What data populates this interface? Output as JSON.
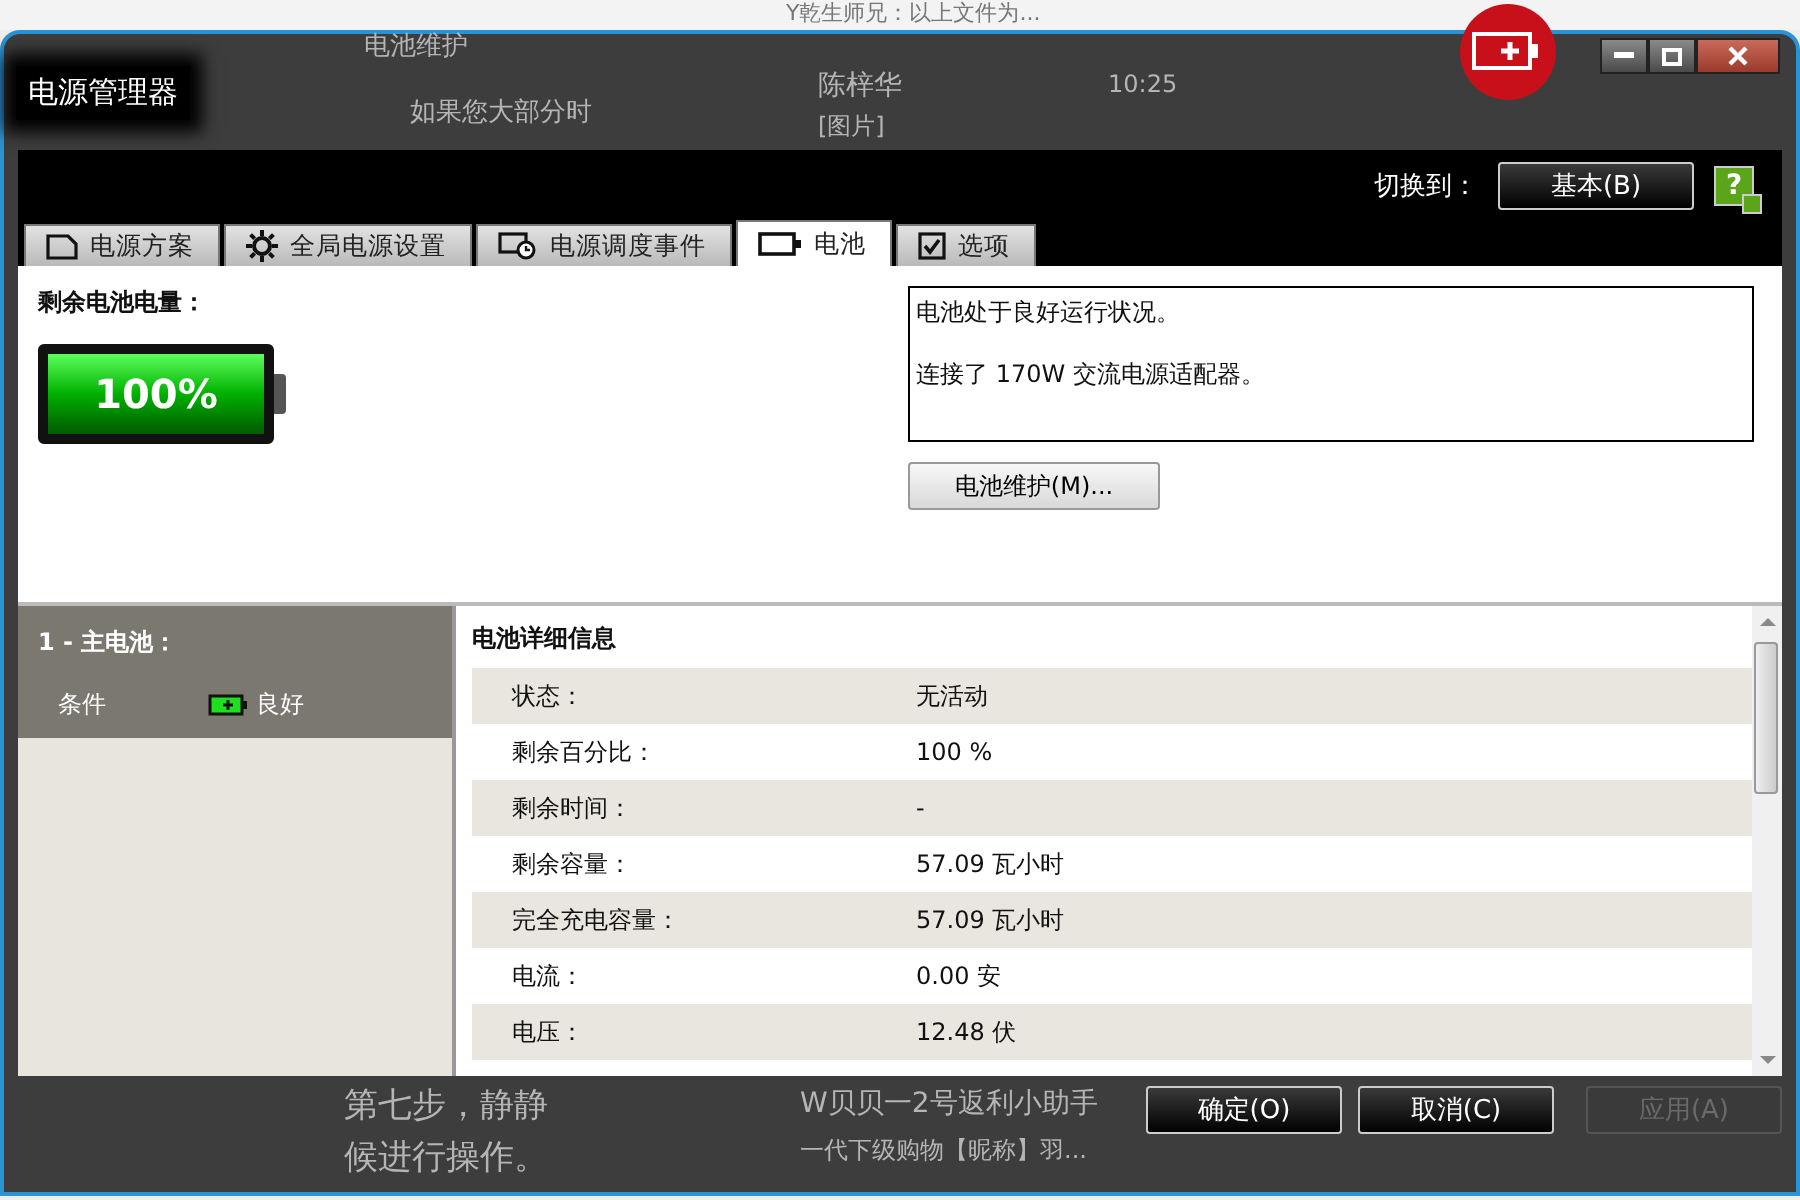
{
  "background": {
    "top_text": "Y乾生师兄：以上文件为...",
    "heading": "电池维护",
    "note": "如果您大部分时",
    "contact_name": "陈梓华",
    "contact_time": "10:25",
    "contact_message": "[图片]",
    "step_line_1": "第七步，静静",
    "step_line_2": "候进行操作。",
    "chat_name": "W贝贝一2号返利小助手",
    "chat_message": "一代下级购物【昵称】羽..."
  },
  "window": {
    "title": "电源管理器"
  },
  "switch": {
    "label": "切换到：",
    "button": "基本(B)",
    "help": "?"
  },
  "tabs": [
    {
      "label": "电源方案",
      "selected": false
    },
    {
      "label": "全局电源设置",
      "selected": false
    },
    {
      "label": "电源调度事件",
      "selected": false
    },
    {
      "label": "电池",
      "selected": true
    },
    {
      "label": "选项",
      "selected": false
    }
  ],
  "charge": {
    "label": "剩余电池电量：",
    "reading": "100%",
    "level": 1.0
  },
  "status_box": [
    "电池处于良好运行状况。",
    "连接了 170W 交流电源适配器。"
  ],
  "maintenance_button": "电池维护(M)...",
  "battery_list": {
    "title": "1 - 主电池：",
    "condition_label": "条件",
    "condition_value": "良好"
  },
  "details": {
    "title": "电池详细信息",
    "rows": [
      {
        "label": "状态：",
        "value": "无活动"
      },
      {
        "label": "剩余百分比：",
        "value": "100 %"
      },
      {
        "label": "剩余时间：",
        "value": "-"
      },
      {
        "label": "剩余容量：",
        "value": "57.09 瓦小时"
      },
      {
        "label": "完全充电容量：",
        "value": "57.09 瓦小时"
      },
      {
        "label": "电流：",
        "value": "0.00 安"
      },
      {
        "label": "电压：",
        "value": "12.48 伏"
      }
    ]
  },
  "buttons": [
    {
      "label": "确定(O)",
      "disabled": false
    },
    {
      "label": "取消(C)",
      "disabled": false
    },
    {
      "label": "应用(A)",
      "disabled": true
    }
  ]
}
